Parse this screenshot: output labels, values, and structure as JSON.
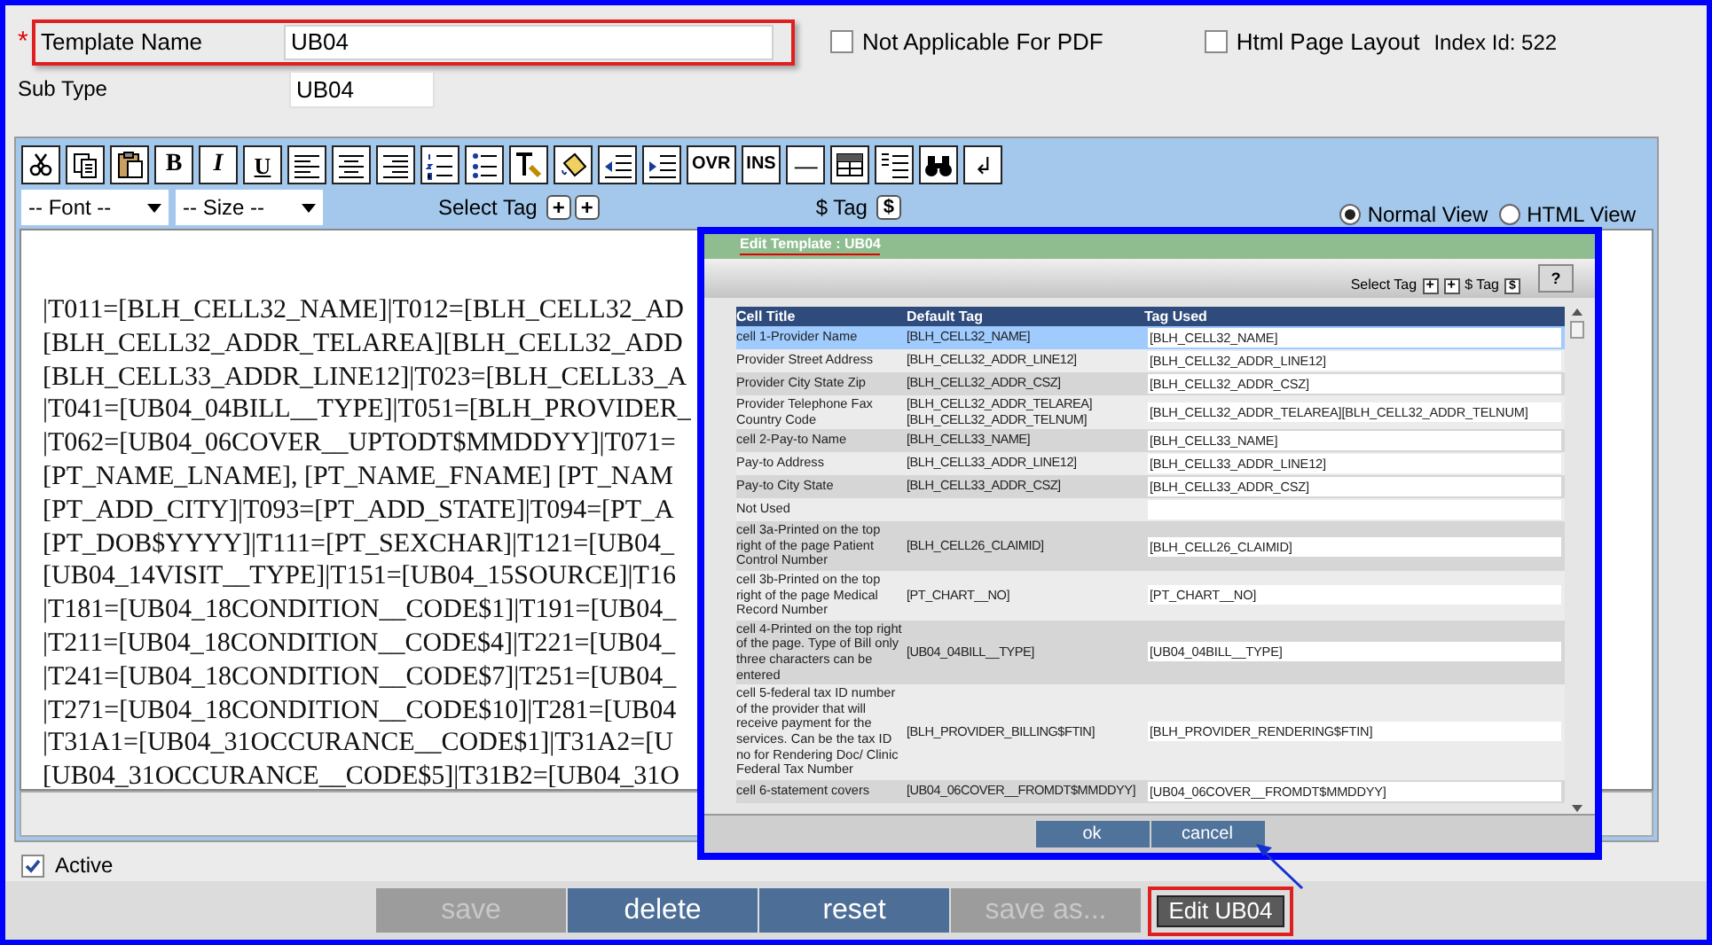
{
  "form": {
    "template_name": {
      "required_mark": "*",
      "label": "Template Name",
      "value": "UB04"
    },
    "not_applicable_pdf": {
      "label": "Not Applicable For PDF",
      "checked": false
    },
    "html_page_layout": {
      "label": "Html Page Layout",
      "checked": false
    },
    "index_id": "Index Id: 522",
    "sub_type": {
      "label": "Sub Type",
      "value": "UB04"
    }
  },
  "editor": {
    "toolbar_text": [
      "B",
      "I",
      "U",
      "OVR",
      "INS",
      "—",
      "↲"
    ],
    "font_select": "-- Font --",
    "size_select": "-- Size --",
    "select_tag": "Select Tag",
    "plus_buttons": [
      "+",
      "+"
    ],
    "dollar_tag": "$ Tag",
    "dollar_button": "$",
    "views": [
      {
        "label": "Normal View",
        "selected": true
      },
      {
        "label": "HTML View",
        "selected": false
      }
    ],
    "lines": [
      "|T011=[BLH_CELL32_NAME]|T012=[BLH_CELL32_AD",
      "[BLH_CELL32_ADDR_TELAREA][BLH_CELL32_ADD",
      "[BLH_CELL33_ADDR_LINE12]|T023=[BLH_CELL33_A",
      "|T041=[UB04_04BILL__TYPE]|T051=[BLH_PROVIDER_",
      "|T062=[UB04_06COVER__UPTODT$MMDDYY]|T071=",
      "[PT_NAME_LNAME], [PT_NAME_FNAME] [PT_NAM",
      "[PT_ADD_CITY]|T093=[PT_ADD_STATE]|T094=[PT_A",
      "[PT_DOB$YYYY]|T111=[PT_SEXCHAR]|T121=[UB04_",
      "[UB04_14VISIT__TYPE]|T151=[UB04_15SOURCE]|T16",
      "|T181=[UB04_18CONDITION__CODE$1]|T191=[UB04_",
      "|T211=[UB04_18CONDITION__CODE$4]|T221=[UB04_",
      "|T241=[UB04_18CONDITION__CODE$7]|T251=[UB04_",
      "|T271=[UB04_18CONDITION__CODE$10]|T281=[UB04",
      "|T31A1=[UB04_31OCCURANCE__CODE$1]|T31A2=[U",
      "[UB04_31OCCURANCE__CODE$5]|T31B2=[UB04_31O"
    ]
  },
  "active": {
    "label": "Active",
    "checked": true
  },
  "buttons": [
    {
      "label": "save",
      "kind": "action",
      "disabled": true
    },
    {
      "label": "delete",
      "kind": "action",
      "disabled": false
    },
    {
      "label": "reset",
      "kind": "action",
      "disabled": false
    },
    {
      "label": "save as...",
      "kind": "action",
      "disabled": true
    },
    {
      "label": "Edit UB04",
      "kind": "edit",
      "disabled": false
    }
  ],
  "dialog": {
    "title": "Edit Template : UB04",
    "select_tag": "Select Tag",
    "plus_buttons": [
      "+",
      "+"
    ],
    "dollar_tag": "$ Tag",
    "dollar_button": "$",
    "help_button": "?",
    "columns": [
      "Cell Title",
      "Default Tag",
      "Tag Used"
    ],
    "rows": [
      {
        "cell_title": "cell 1-Provider Name",
        "default_tag": "[BLH_CELL32_NAME]",
        "tag_used": "[BLH_CELL32_NAME]",
        "selected": true
      },
      {
        "cell_title": "Provider Street Address",
        "default_tag": "[BLH_CELL32_ADDR_LINE12]",
        "tag_used": "[BLH_CELL32_ADDR_LINE12]",
        "selected": false
      },
      {
        "cell_title": "Provider City State Zip",
        "default_tag": "[BLH_CELL32_ADDR_CSZ]",
        "tag_used": "[BLH_CELL32_ADDR_CSZ]",
        "selected": false
      },
      {
        "cell_title": "Provider Telephone Fax Country Code",
        "default_tag": "[BLH_CELL32_ADDR_TELAREA] [BLH_CELL32_ADDR_TELNUM]",
        "tag_used": "[BLH_CELL32_ADDR_TELAREA][BLH_CELL32_ADDR_TELNUM]",
        "selected": false
      },
      {
        "cell_title": "cell 2-Pay-to Name",
        "default_tag": "[BLH_CELL33_NAME]",
        "tag_used": "[BLH_CELL33_NAME]",
        "selected": false
      },
      {
        "cell_title": "Pay-to Address",
        "default_tag": "[BLH_CELL33_ADDR_LINE12]",
        "tag_used": "[BLH_CELL33_ADDR_LINE12]",
        "selected": false
      },
      {
        "cell_title": "Pay-to City State",
        "default_tag": "[BLH_CELL33_ADDR_CSZ]",
        "tag_used": "[BLH_CELL33_ADDR_CSZ]",
        "selected": false
      },
      {
        "cell_title": "Not Used",
        "selected": false
      },
      {
        "cell_title": "cell 3a-Printed on the top right of the page Patient Control Number",
        "default_tag": "[BLH_CELL26_CLAIMID]",
        "tag_used": "[BLH_CELL26_CLAIMID]",
        "selected": false
      },
      {
        "cell_title": "cell 3b-Printed on the top right of the page Medical Record Number",
        "default_tag": "[PT_CHART__NO]",
        "tag_used": "[PT_CHART__NO]",
        "selected": false
      },
      {
        "cell_title": "cell 4-Printed on the top right of the page. Type of Bill only three characters can be entered",
        "default_tag": "[UB04_04BILL__TYPE]",
        "tag_used": "[UB04_04BILL__TYPE]",
        "selected": false
      },
      {
        "cell_title": "cell 5-federal tax ID number of the provider that will receive payment for the services. Can be the tax ID no for Rendering Doc/ Clinic Federal Tax Number",
        "default_tag": "[BLH_PROVIDER_BILLING$FTIN]",
        "tag_used": "[BLH_PROVIDER_RENDERING$FTIN]",
        "selected": false
      },
      {
        "cell_title": "cell 6-statement covers",
        "default_tag": "[UB04_06COVER__FROMDT$MMDDYY]",
        "tag_used": "[UB04_06COVER__FROMDT$MMDDYY]",
        "selected": false
      }
    ],
    "buttons": [
      "ok",
      "cancel"
    ]
  }
}
